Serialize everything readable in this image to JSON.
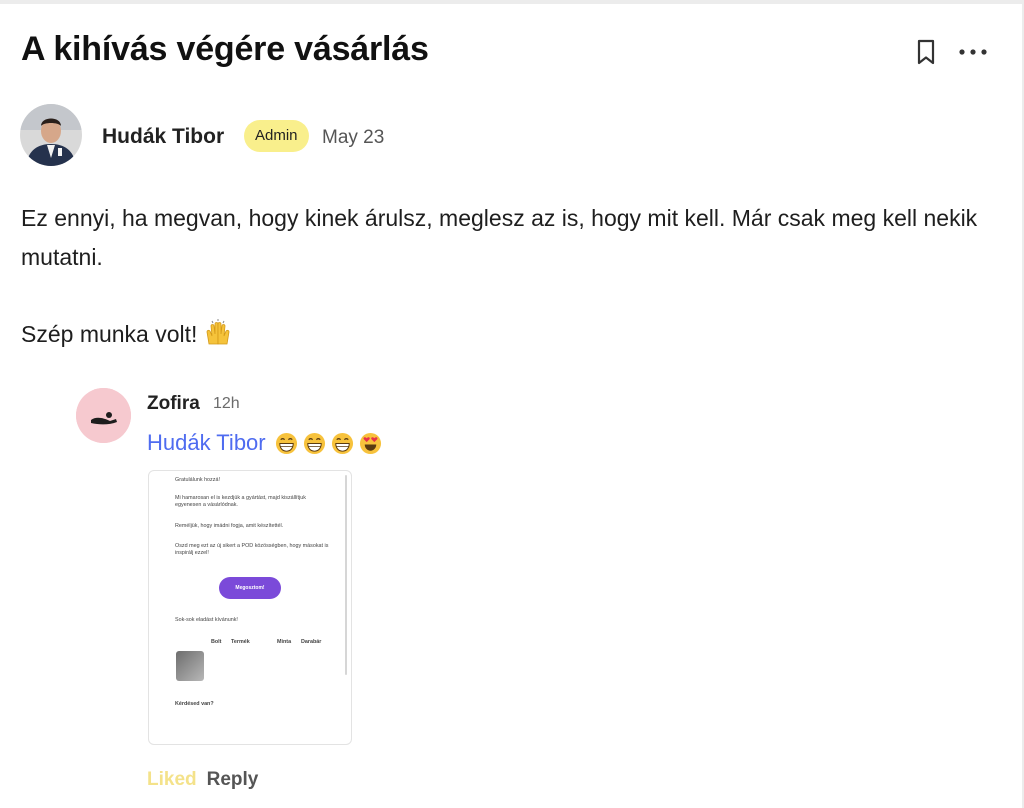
{
  "post": {
    "title": "A kihívás végére vásárlás",
    "author": "Hudák Tibor",
    "role_badge": "Admin",
    "date": "May 23",
    "body_line1": "Ez ennyi, ha megvan, hogy kinek árulsz, meglesz az is, hogy mit kell. Már csak meg kell nekik mutatni.",
    "body_line2": "Szép munka volt!",
    "body_emoji": "raising-hands-emoji"
  },
  "comment": {
    "author": "Zofira",
    "time": "12h",
    "mention": "Hudák Tibor",
    "emojis": [
      "grinning-face-emoji",
      "grinning-face-emoji",
      "grinning-face-emoji",
      "heart-eyes-emoji"
    ],
    "attachment": {
      "lines": [
        "Gratulálunk hozzá!",
        "Mi hamarosan el is kezdjük a gyártást, majd kiszállítjuk egyenesen a vásárlódnak.",
        "Reméljük, hogy imádni fogja, amit készítettél.",
        "Oszd meg ezt az új sikert a POD közösségben, hogy másokat is inspirálj ezzel!",
        "Sok-sok eladást kívánunk!",
        "Kérdésed van?"
      ],
      "button_label": "Megosztom!",
      "table_headers": [
        "Bolt",
        "Termék",
        "Minta",
        "Darabár"
      ]
    },
    "liked_label": "Liked",
    "reply_label": "Reply"
  },
  "colors": {
    "accent_link": "#4f6cf0",
    "badge_bg": "#f9ef8c",
    "liked": "#f4e28a",
    "mini_button": "#7b4ad9"
  },
  "icons": {
    "bookmark": "bookmark-icon",
    "more": "more-horizontal-icon"
  }
}
